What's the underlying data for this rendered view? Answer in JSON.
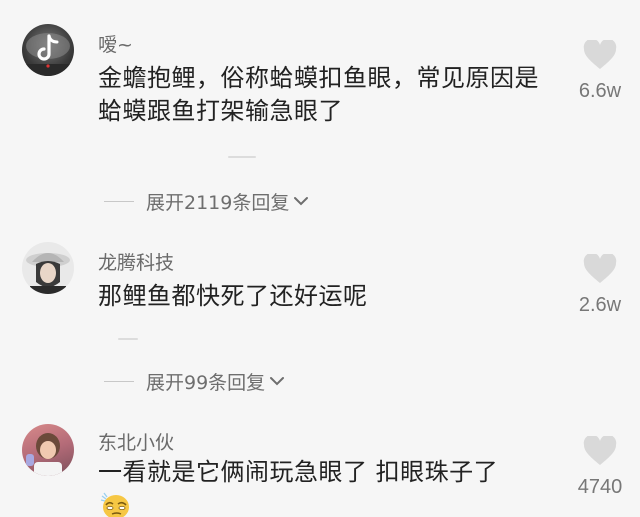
{
  "comments": [
    {
      "username": "嗳~",
      "text": "金蟾抱鲤，俗称蛤蟆扣鱼眼，常见原因是蛤蟆跟鱼打架输急眼了",
      "likes": "6.6w",
      "avatar_icon": "tiktok-logo-avatar",
      "replies_label": "展开2119条回复"
    },
    {
      "username": "龙腾科技",
      "text": "那鲤鱼都快死了还好运呢",
      "likes": "2.6w",
      "avatar_icon": "person-photo-avatar",
      "replies_label": "展开99条回复"
    },
    {
      "username": "东北小伙",
      "text": "一看就是它俩闹玩急眼了 扣眼珠子了",
      "likes": "4740",
      "avatar_icon": "person-photo-avatar",
      "emoji_icon": "smirk-emoji"
    }
  ],
  "colors": {
    "background": "#f6f6f6",
    "username": "#6a6a6a",
    "text": "#222222",
    "muted": "#777777",
    "heart": "#d9d9d9"
  }
}
